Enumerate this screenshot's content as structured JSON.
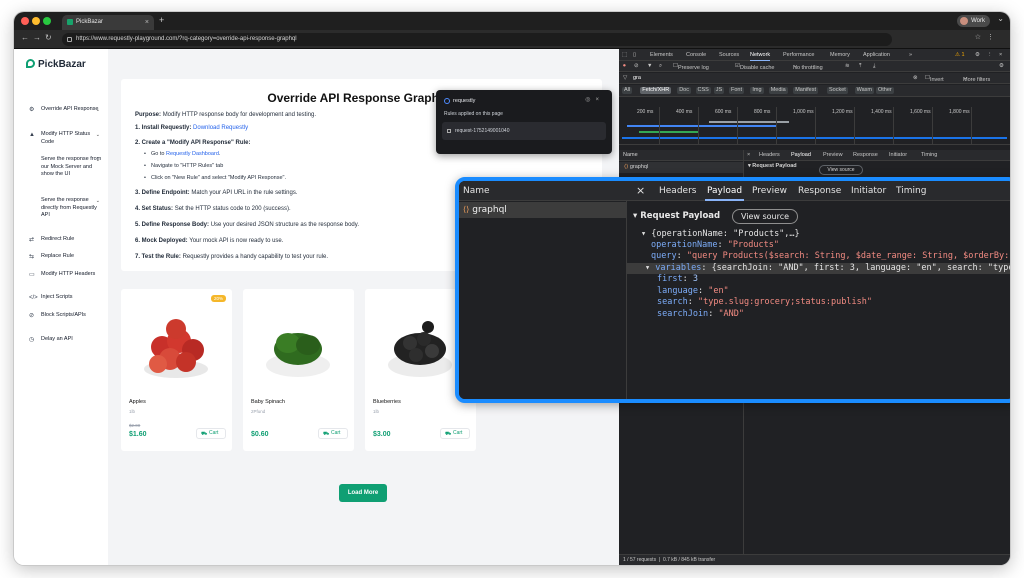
{
  "browser": {
    "tab_title": "PickBazar",
    "url": "https://www.requestly-playground.com/?rq-category=override-api-response-graphql",
    "profile": "Work"
  },
  "site": {
    "logo": "PickBazar",
    "sidebar": [
      {
        "label": "Override API Response",
        "icon": "override-icon",
        "chevron": true
      },
      {
        "label": "Modify HTTP Status Code",
        "icon": "status-icon",
        "chevron": true
      },
      {
        "label": "Serve the response from our Mock Server and show the UI",
        "icon": "",
        "chevron": true
      },
      {
        "label": "Serve the response directly from Requestly API",
        "icon": "",
        "chevron": true
      },
      {
        "label": "Redirect Rule",
        "icon": "redirect-icon",
        "chevron": false
      },
      {
        "label": "Replace Rule",
        "icon": "replace-icon",
        "chevron": false
      },
      {
        "label": "Modify HTTP Headers",
        "icon": "headers-icon",
        "chevron": false
      },
      {
        "label": "Inject Scripts",
        "icon": "code-icon",
        "chevron": false
      },
      {
        "label": "Block Scripts/APIs",
        "icon": "block-icon",
        "chevron": false
      },
      {
        "label": "Delay an API",
        "icon": "clock-icon",
        "chevron": false
      }
    ],
    "card": {
      "title": "Override API Response GraphQL",
      "purpose_label": "Purpose:",
      "purpose_text": "Modify HTTP response body for development and testing.",
      "step1_label": "1. Install Requestly:",
      "step1_link": "Download Requestly",
      "step2_label": "2. Create a \"Modify API Response\" Rule:",
      "step2_sub1_prefix": "Go to ",
      "step2_sub1_link": "Requestly Dashboard",
      "step2_sub1_suffix": ".",
      "step2_sub2": "Navigate to \"HTTP Rules\" tab",
      "step2_sub3": "Click on \"New Rule\" and select \"Modify API Response\".",
      "step3_label": "3. Define Endpoint:",
      "step3_text": "Match your API URL in the rule settings.",
      "step4_label": "4. Set Status:",
      "step4_text": "Set the HTTP status code to 200 (success).",
      "step5_label": "5. Define Response Body:",
      "step5_text": "Use your desired JSON structure as the response body.",
      "step6_label": "6. Mock Deployed:",
      "step6_text": "Your mock API is now ready to use.",
      "step7_label": "7. Test the Rule:",
      "step7_text": "Requestly provides a handy capability to test your rule."
    },
    "products": [
      {
        "name": "Apples",
        "unit": "1lb",
        "old_price": "$2.00",
        "price": "$1.60",
        "badge": "20%",
        "cart": "Cart"
      },
      {
        "name": "Baby Spinach",
        "unit": "2Pfund",
        "old_price": "",
        "price": "$0.60",
        "badge": "",
        "cart": "Cart"
      },
      {
        "name": "Blueberries",
        "unit": "1lb",
        "old_price": "",
        "price": "$3.00",
        "badge": "",
        "cart": "Cart"
      }
    ],
    "load_more": "Load More"
  },
  "requestly_popup": {
    "brand": "requestly",
    "applied": "Rules applied on this page",
    "rule": "request-1752149001040"
  },
  "devtools": {
    "tabs": [
      "Elements",
      "Console",
      "Sources",
      "Network",
      "Performance",
      "Memory",
      "Application"
    ],
    "active_tab": "Network",
    "warn_count": "1",
    "preserve_log": "Preserve log",
    "disable_cache": "Disable cache",
    "throttling": "No throttling",
    "filter_value": "gra",
    "invert": "Invert",
    "more_filters": "More filters",
    "type_filters": [
      "All",
      "Fetch/XHR",
      "Doc",
      "CSS",
      "JS",
      "Font",
      "Img",
      "Media",
      "Manifest",
      "Socket",
      "Wasm",
      "Other"
    ],
    "active_filter": "Fetch/XHR",
    "ticks": [
      "200 ms",
      "400 ms",
      "600 ms",
      "800 ms",
      "1,000 ms",
      "1,200 ms",
      "1,400 ms",
      "1,600 ms",
      "1,800 ms"
    ],
    "name_header": "Name",
    "request_name": "graphql",
    "detail_tabs": [
      "Headers",
      "Payload",
      "Preview",
      "Response",
      "Initiator",
      "Timing"
    ],
    "active_detail": "Payload",
    "request_payload": "Request Payload",
    "view_source": "View source",
    "footer_requests": "1 / 57 requests",
    "footer_transfer": "0.7 kB / 845 kB transfer"
  },
  "payload": {
    "root": "{operationName: \"Products\",…}",
    "operationName_key": "operationName",
    "operationName_val": "\"Products\"",
    "query_key": "query",
    "query_val": "\"query Products($search: String, $date_range: String, $orderBy: String, $sortedBy: String, $language: String, $searchJoin: String, $first: Int, $page: Int",
    "variables_key": "variables",
    "variables_val": "{searchJoin: \"AND\", first: 3, language: \"en\", search: \"type.slug:grocery;status:publish\"}",
    "first_key": "first",
    "first_val": "3",
    "language_key": "language",
    "language_val": "\"en\"",
    "search_key": "search",
    "search_val": "\"type.slug:grocery;status:publish\"",
    "searchJoin_key": "searchJoin",
    "searchJoin_val": "\"AND\""
  },
  "colors": {
    "brand_green": "#0f9f73",
    "zoom_border": "#1a8cff",
    "devtools_bg": "#202124"
  }
}
